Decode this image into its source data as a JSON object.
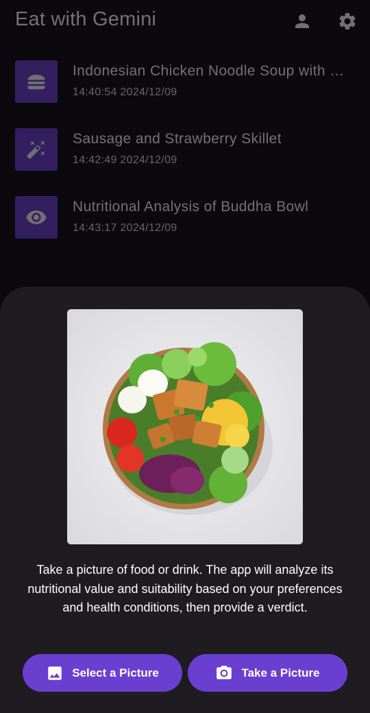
{
  "app": {
    "title": "Eat with Gemini"
  },
  "top_icons": {
    "profile": "person-icon",
    "settings": "gear-icon"
  },
  "history": [
    {
      "title": "Indonesian Chicken Noodle Soup with Vegetables",
      "time": "14:40:54 2024/12/09",
      "icon": "burger-icon"
    },
    {
      "title": "Sausage and Strawberry Skillet",
      "time": "14:42:49 2024/12/09",
      "icon": "magic-wand-icon"
    },
    {
      "title": "Nutritional Analysis of Buddha Bowl",
      "time": "14:43:17 2024/12/09",
      "icon": "eye-icon"
    }
  ],
  "sheet": {
    "description": "Take a picture of food or drink. The app will analyze its nutritional value and suitability based on your preferences and health conditions, then provide a verdict.",
    "select_button": "Select a Picture",
    "take_button": "Take a Picture"
  },
  "colors": {
    "accent": "#6a3fd0",
    "background": "#0b090d",
    "sheet": "#1e1b21"
  }
}
